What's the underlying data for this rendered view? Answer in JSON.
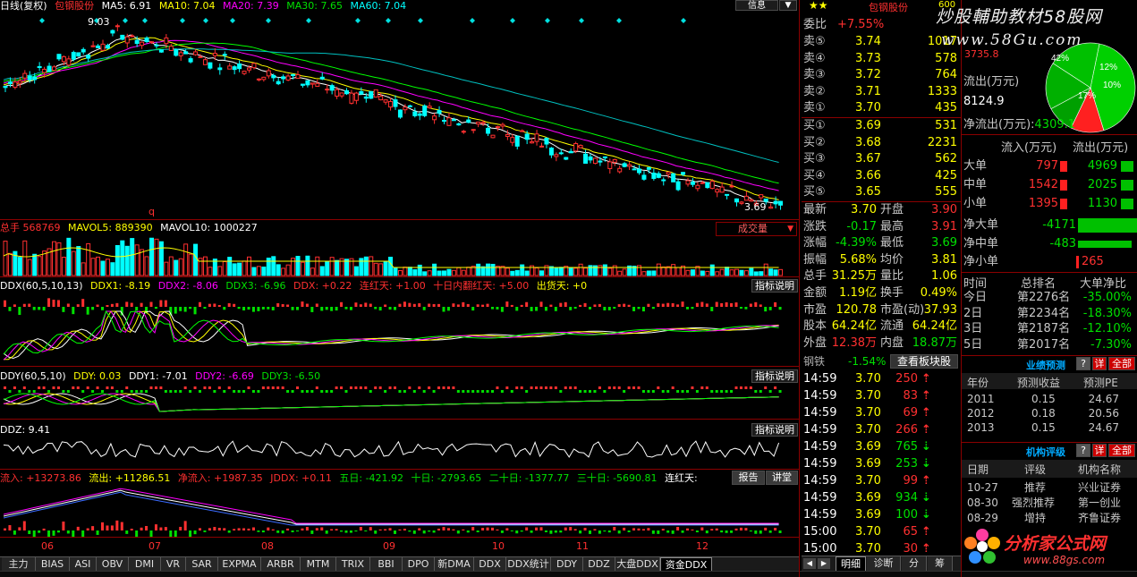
{
  "main": {
    "left_label": "日线(复权)",
    "stock_name": "包钢股份",
    "ma": [
      "MA5: 6.91",
      "MA10: 7.04",
      "MA20: 7.39",
      "MA30: 7.65",
      "MA60: 7.04"
    ],
    "high_label": "9.03",
    "low_label": "3.69",
    "marker_q": "q",
    "right_buttons": [
      "信息"
    ]
  },
  "volume": {
    "header": [
      "总手 568769",
      "MAVOL5: 889390",
      "MAVOL10: 1000227"
    ],
    "select": "成交量"
  },
  "ddx": {
    "header": [
      "DDX(60,5,10,13)",
      "DDX1: -8.19",
      "DDX2: -8.06",
      "DDX3: -6.96",
      "DDX: +0.22",
      "连红天: +1.00",
      "十日内翻红天: +5.00",
      "出货天: +0"
    ],
    "help": "指标说明"
  },
  "ddy": {
    "header": [
      "DDY(60,5,10)",
      "DDY: 0.03",
      "DDY1: -7.01",
      "DDY2: -6.69",
      "DDY3: -6.50"
    ],
    "help": "指标说明"
  },
  "ddz": {
    "header": [
      "DDZ: 9.41"
    ],
    "help": "指标说明"
  },
  "flow": {
    "header": [
      "流入: +13273.86",
      "流出: +11286.51",
      "净流入: +1987.35",
      "JDDX: +0.11",
      "五日: -421.92",
      "十日: -2793.65",
      "二十日: -1377.77",
      "三十日: -5690.81",
      "连红天:"
    ],
    "buttons": [
      "报告",
      "讲堂"
    ]
  },
  "x_months": [
    "06",
    "07",
    "08",
    "09",
    "10",
    "11",
    "12"
  ],
  "tabs": [
    "主力",
    "BIAS",
    "ASI",
    "OBV",
    "DMI",
    "VR",
    "SAR",
    "EXPMA",
    "ARBR",
    "MTM",
    "TRIX",
    "BBI",
    "DPO",
    "新DMA",
    "DDX",
    "DDX统计",
    "DDY",
    "DDZ",
    "大盘DDX",
    "资金DDX"
  ],
  "active_tab": "资金DDX",
  "quote": {
    "stars": "★★",
    "name": "包钢股份",
    "code_part": "600",
    "weibi_label": "委比",
    "weibi": "+7.55%",
    "sells": [
      {
        "label": "卖⑤",
        "price": "3.74",
        "vol": "1017"
      },
      {
        "label": "卖④",
        "price": "3.73",
        "vol": "578"
      },
      {
        "label": "卖③",
        "price": "3.72",
        "vol": "764"
      },
      {
        "label": "卖②",
        "price": "3.71",
        "vol": "1333"
      },
      {
        "label": "卖①",
        "price": "3.70",
        "vol": "435"
      }
    ],
    "buys": [
      {
        "label": "买①",
        "price": "3.69",
        "vol": "531"
      },
      {
        "label": "买②",
        "price": "3.68",
        "vol": "2231"
      },
      {
        "label": "买③",
        "price": "3.67",
        "vol": "562"
      },
      {
        "label": "买④",
        "price": "3.66",
        "vol": "425"
      },
      {
        "label": "买⑤",
        "price": "3.65",
        "vol": "555"
      }
    ],
    "stats": [
      {
        "l1": "最新",
        "v1": "3.70",
        "l2": "开盘",
        "v2": "3.90"
      },
      {
        "l1": "涨跌",
        "v1": "-0.17",
        "l2": "最高",
        "v2": "3.91"
      },
      {
        "l1": "涨幅",
        "v1": "-4.39%",
        "l2": "最低",
        "v2": "3.69"
      },
      {
        "l1": "振幅",
        "v1": "5.68%",
        "l2": "均价",
        "v2": "3.81"
      },
      {
        "l1": "总手",
        "v1": "31.25万",
        "l2": "量比",
        "v2": "1.06"
      },
      {
        "l1": "金额",
        "v1": "1.19亿",
        "l2": "换手",
        "v2": "0.49%"
      },
      {
        "l1": "市盈",
        "v1": "120.78",
        "l2": "市盈(动)",
        "v2": "37.93"
      },
      {
        "l1": "股本",
        "v1": "64.24亿",
        "l2": "流通",
        "v2": "64.24亿"
      },
      {
        "l1": "外盘",
        "v1": "12.38万",
        "l2": "内盘",
        "v2": "18.87万"
      }
    ],
    "sector_label": "钢铁",
    "sector_pct": "-1.54%",
    "sector_btn": "查看板块股"
  },
  "ticks": [
    {
      "t": "14:59",
      "p": "3.70",
      "v": "250",
      "d": "up"
    },
    {
      "t": "14:59",
      "p": "3.70",
      "v": "83",
      "d": "up"
    },
    {
      "t": "14:59",
      "p": "3.70",
      "v": "69",
      "d": "up"
    },
    {
      "t": "14:59",
      "p": "3.70",
      "v": "266",
      "d": "up"
    },
    {
      "t": "14:59",
      "p": "3.69",
      "v": "765",
      "d": "down"
    },
    {
      "t": "14:59",
      "p": "3.69",
      "v": "253",
      "d": "down"
    },
    {
      "t": "14:59",
      "p": "3.70",
      "v": "99",
      "d": "up"
    },
    {
      "t": "14:59",
      "p": "3.69",
      "v": "934",
      "d": "down"
    },
    {
      "t": "14:59",
      "p": "3.69",
      "v": "100",
      "d": "down"
    },
    {
      "t": "15:00",
      "p": "3.70",
      "v": "65",
      "d": "up"
    },
    {
      "t": "15:00",
      "p": "3.70",
      "v": "30",
      "d": "up"
    }
  ],
  "tick_tabs": [
    "明细",
    "诊断",
    "分",
    "筹"
  ],
  "right": {
    "watermark1": "炒股輔助教材58股网",
    "watermark2": "www.58Gu.com",
    "small_num": "3735.8",
    "outflow_label": "流出(万元)",
    "outflow_val": "8124.9",
    "net_label": "净流出(万元):",
    "net_val": "4309.1",
    "pie": [
      {
        "label": "42%",
        "value": 42
      },
      {
        "label": "12%",
        "value": 12
      },
      {
        "label": "10%",
        "value": 10
      },
      {
        "label": "17%",
        "value": 17
      }
    ],
    "flow_head": [
      "流入(万元)",
      "流出(万元)"
    ],
    "flow_rows": [
      {
        "name": "大单",
        "in": "797",
        "out": "4969"
      },
      {
        "name": "中单",
        "in": "1542",
        "out": "2025"
      },
      {
        "name": "小单",
        "in": "1395",
        "out": "1130"
      }
    ],
    "net_rows": [
      {
        "name": "净大单",
        "val": "-4171"
      },
      {
        "name": "净中单",
        "val": "-483"
      },
      {
        "name": "净小单",
        "val": "265"
      }
    ],
    "rank_head": [
      "时间",
      "总排名",
      "大单净比"
    ],
    "rank_rows": [
      {
        "t": "今日",
        "r": "第2276名",
        "p": "-35.00%"
      },
      {
        "t": "2日",
        "r": "第2234名",
        "p": "-18.30%"
      },
      {
        "t": "3日",
        "r": "第2187名",
        "p": "-12.10%"
      },
      {
        "t": "5日",
        "r": "第2017名",
        "p": "-7.30%"
      }
    ],
    "forecast_title": "业绩预测",
    "forecast_head": [
      "年份",
      "预测收益",
      "预测PE"
    ],
    "forecast_rows": [
      {
        "y": "2011",
        "e": "0.15",
        "pe": "24.67"
      },
      {
        "y": "2012",
        "e": "0.18",
        "pe": "20.56"
      },
      {
        "y": "2013",
        "e": "0.15",
        "pe": "24.67"
      }
    ],
    "rating_title": "机构评级",
    "rating_head": [
      "日期",
      "评级",
      "机构名称"
    ],
    "rating_rows": [
      {
        "d": "10-27",
        "r": "推荐",
        "o": "兴业证券"
      },
      {
        "d": "08-30",
        "r": "强烈推荐",
        "o": "第一创业"
      },
      {
        "d": "08-29",
        "r": "增持",
        "o": "齐鲁证券"
      }
    ],
    "btn_q": "?",
    "btn_detail": "详",
    "btn_all": "全部",
    "logo": "分析家公式网",
    "logo_url": "www.88gs.com"
  }
}
